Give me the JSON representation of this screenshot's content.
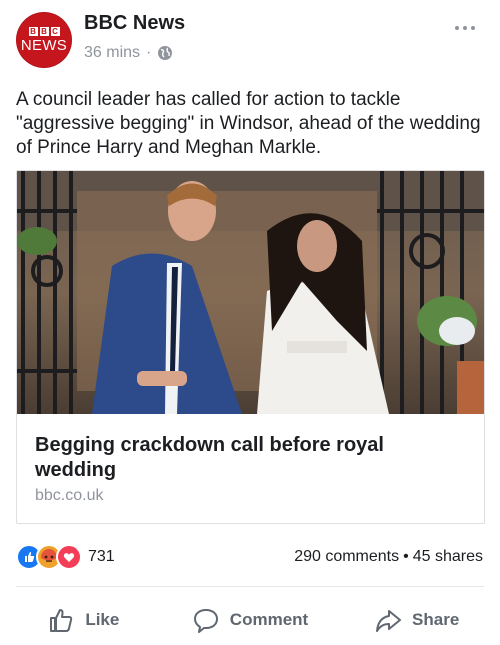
{
  "post": {
    "page_name": "BBC News",
    "avatar_brand": "BBC",
    "avatar_word": "NEWS",
    "time": "36 mins",
    "privacy_icon": "globe-icon",
    "more_icon": "more-dots-icon",
    "text": "A council leader has called for action to tackle \"aggressive begging\" in Windsor, ahead of the wedding of Prince Harry and Meghan Markle."
  },
  "link_card": {
    "image_icon": "photo",
    "title": "Begging crackdown call before royal wedding",
    "domain": "bbc.co.uk"
  },
  "reactions": {
    "types": [
      "like",
      "angry",
      "love"
    ],
    "count": "731"
  },
  "counts": {
    "comments": "290 comments",
    "separator": "•",
    "shares": "45 shares"
  },
  "actions": {
    "like": "Like",
    "comment": "Comment",
    "share": "Share"
  },
  "colors": {
    "brand_red": "#c4161c",
    "like_blue": "#1877f2",
    "angry_orange": "#f0a12b",
    "love_red": "#f33e58",
    "muted_text": "#90949c"
  }
}
